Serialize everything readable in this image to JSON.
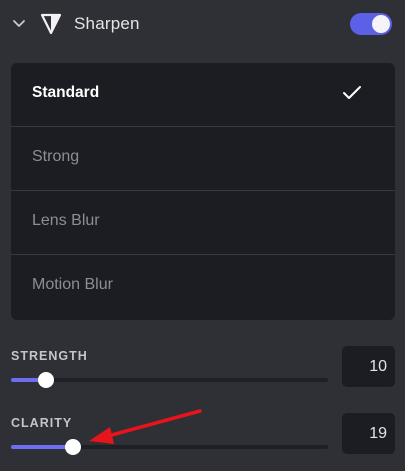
{
  "header": {
    "title": "Sharpen",
    "enabled": true,
    "icons": {
      "collapse": "chevron-down-icon",
      "effect": "sharpen-triangle-icon"
    }
  },
  "options": [
    {
      "label": "Standard",
      "selected": true
    },
    {
      "label": "Strong",
      "selected": false
    },
    {
      "label": "Lens Blur",
      "selected": false
    },
    {
      "label": "Motion Blur",
      "selected": false
    }
  ],
  "sliders": {
    "strength": {
      "label": "STRENGTH",
      "value": "10",
      "fraction": 0.11
    },
    "clarity": {
      "label": "CLARITY",
      "value": "19",
      "fraction": 0.195
    }
  },
  "colors": {
    "accent": "#5b61e6",
    "annotation": "#e8141b"
  }
}
